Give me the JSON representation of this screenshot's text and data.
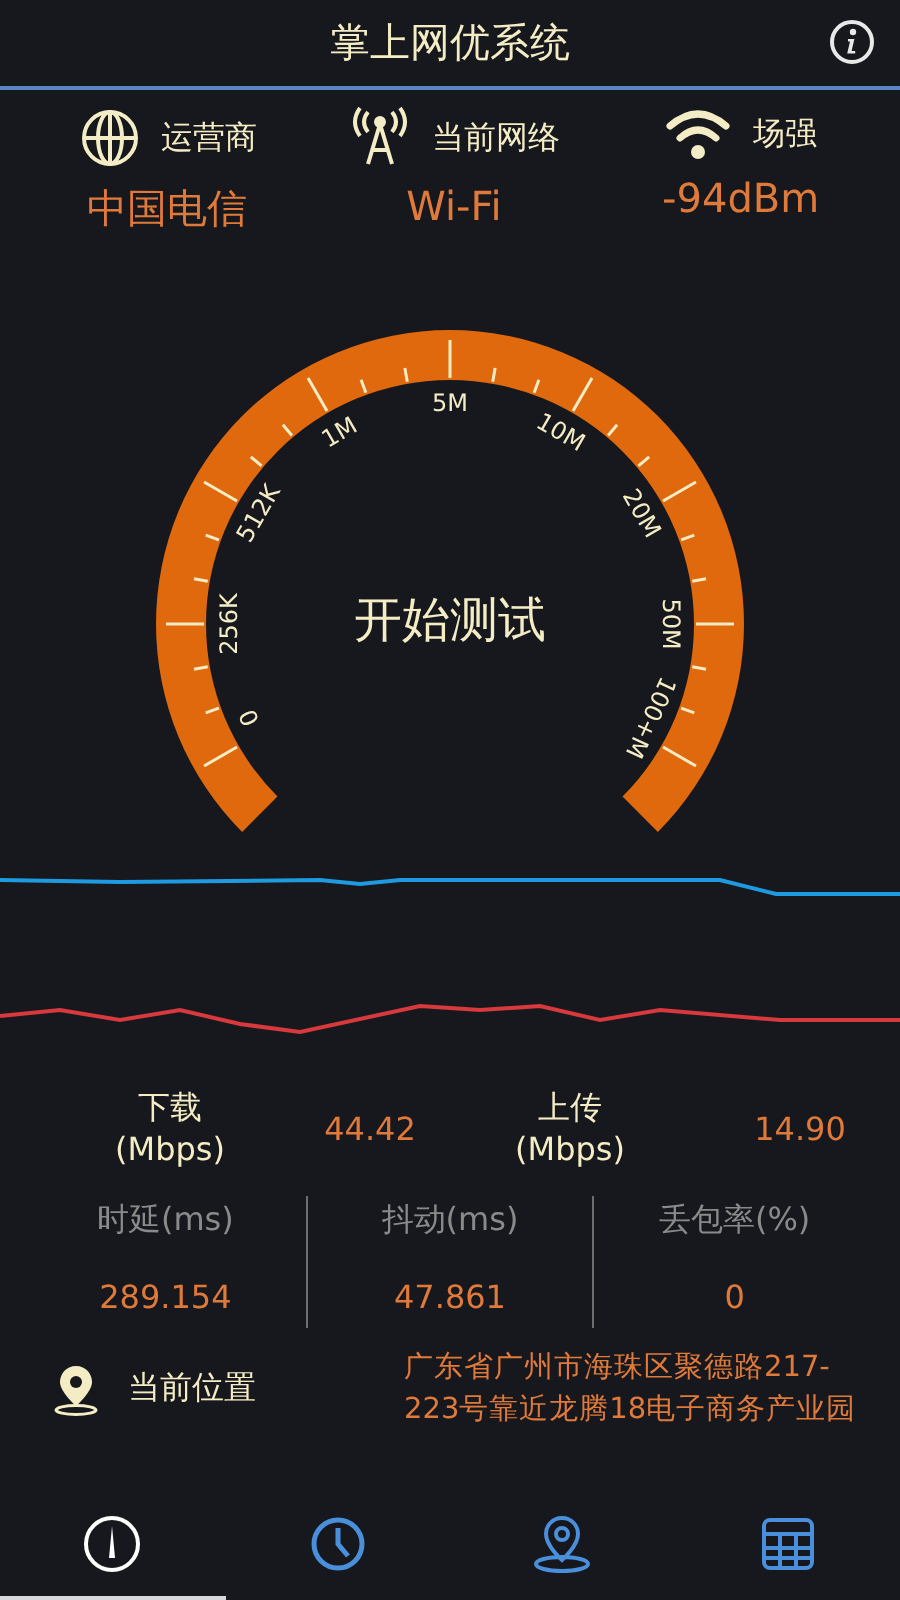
{
  "header": {
    "title": "掌上网优系统"
  },
  "network_info": [
    {
      "kind": "carrier",
      "label": "运营商",
      "value": "中国电信"
    },
    {
      "kind": "network",
      "label": "当前网络",
      "value": "Wi-Fi"
    },
    {
      "kind": "signal",
      "label": "场强",
      "value": "-94dBm"
    }
  ],
  "gauge": {
    "scale_labels": [
      "0",
      "256K",
      "512K",
      "1M",
      "5M",
      "10M",
      "20M",
      "50M",
      "100+M"
    ],
    "button": "开始测试"
  },
  "speeds": [
    {
      "label": "下载",
      "unit": "(Mbps)",
      "value": "44.42"
    },
    {
      "label": "上传",
      "unit": "(Mbps)",
      "value": "14.90"
    }
  ],
  "quality": [
    {
      "label": "时延(ms)",
      "value": "289.154"
    },
    {
      "label": "抖动(ms)",
      "value": "47.861"
    },
    {
      "label": "丢包率(%)",
      "value": "0"
    }
  ],
  "location": {
    "label": "当前位置",
    "address": "广东省广州市海珠区聚德路217-223号靠近龙腾18电子商务产业园"
  },
  "bottom_nav": [
    {
      "kind": "speedometer",
      "selected": true
    },
    {
      "kind": "clock",
      "selected": false
    },
    {
      "kind": "pin",
      "selected": false
    },
    {
      "kind": "grid",
      "selected": false
    }
  ]
}
